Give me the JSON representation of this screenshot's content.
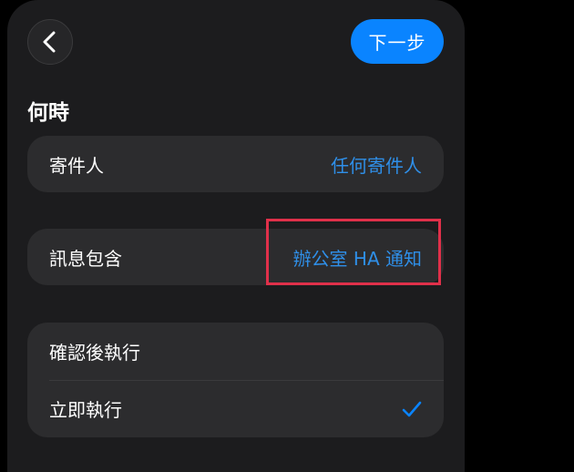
{
  "header": {
    "next_label": "下一步"
  },
  "section": {
    "title": "何時"
  },
  "sender": {
    "label": "寄件人",
    "value": "任何寄件人"
  },
  "keyword": {
    "label": "訊息包含",
    "value": "辦公室 HA 通知"
  },
  "run_mode": {
    "options": [
      {
        "label": "確認後執行",
        "selected": false
      },
      {
        "label": "立即執行",
        "selected": true
      }
    ]
  },
  "colors": {
    "accent": "#0a84ff",
    "value_text": "#2f8fe8",
    "highlight": "#e0304a",
    "card": "#2c2c2e",
    "sheet": "#1c1c1e"
  }
}
